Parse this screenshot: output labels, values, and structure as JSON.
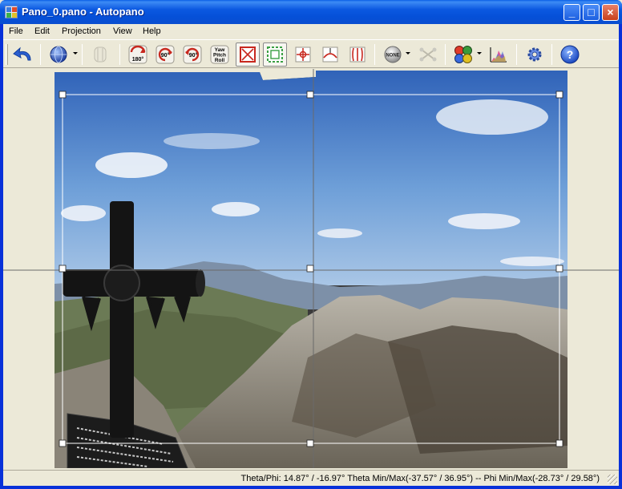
{
  "window": {
    "title": "Pano_0.pano - Autopano",
    "minimize_label": "_",
    "maximize_label": "□",
    "close_label": "×"
  },
  "menu": {
    "items": [
      {
        "label": "File"
      },
      {
        "label": "Edit"
      },
      {
        "label": "Projection"
      },
      {
        "label": "View"
      },
      {
        "label": "Help"
      }
    ]
  },
  "toolbar": {
    "undo": {
      "icon": "undo-arrow-icon"
    },
    "projection": {
      "icon": "globe-icon"
    },
    "panorama_disabled": {
      "icon": "panorama-cylinder-icon"
    },
    "rotate_180": {
      "label": "180°",
      "icon": "rotate-180-icon"
    },
    "rotate_ccw_90": {
      "label": "90°",
      "icon": "rotate-ccw-90-icon"
    },
    "rotate_cw_90": {
      "label": "90°",
      "icon": "rotate-cw-90-icon"
    },
    "yaw_pitch_roll": {
      "lines": [
        "Yaw",
        "Pitch",
        "Roll"
      ],
      "icon": "yaw-pitch-roll-icon"
    },
    "fit_crop": {
      "icon": "crop-fit-icon"
    },
    "crop_auto": {
      "icon": "crop-auto-icon"
    },
    "center": {
      "icon": "center-target-icon"
    },
    "straighten": {
      "icon": "straighten-horizon-icon"
    },
    "vertical_lines": {
      "icon": "vertical-lines-icon"
    },
    "blend_mode": {
      "label": "NONE",
      "icon": "blend-none-icon"
    },
    "control_points": {
      "icon": "control-points-icon"
    },
    "color": {
      "icon": "color-balls-icon"
    },
    "histogram": {
      "icon": "histogram-icon"
    },
    "settings": {
      "icon": "gear-icon"
    },
    "help": {
      "label": "?",
      "icon": "help-icon"
    }
  },
  "status": {
    "text": "Theta/Phi: 14.87° / -16.97°  Theta Min/Max(-37.57° / 36.95°)   --   Phi Min/Max(-28.73° / 29.58°)"
  },
  "colors": {
    "titlebar": "#0a58e0",
    "chrome": "#ece9d8",
    "sky": "#3f7fd0",
    "ridge": "#8f8a7d"
  }
}
